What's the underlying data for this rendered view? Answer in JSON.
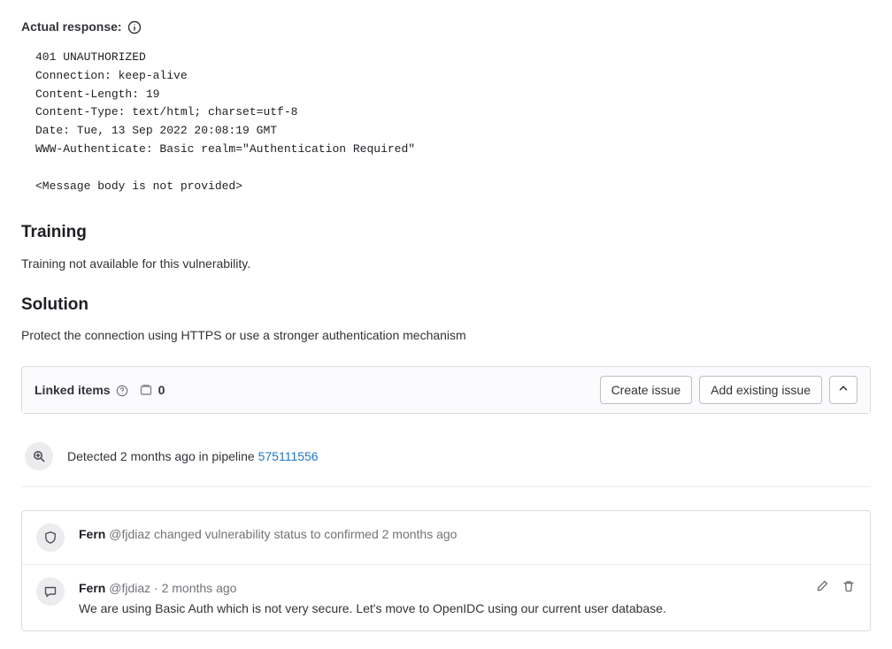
{
  "response": {
    "label": "Actual response:",
    "body": "401 UNAUTHORIZED\nConnection: keep-alive\nContent-Length: 19\nContent-Type: text/html; charset=utf-8\nDate: Tue, 13 Sep 2022 20:08:19 GMT\nWWW-Authenticate: Basic realm=\"Authentication Required\"\n\n<Message body is not provided>"
  },
  "training": {
    "heading": "Training",
    "text": "Training not available for this vulnerability."
  },
  "solution": {
    "heading": "Solution",
    "text": "Protect the connection using HTTPS or use a stronger authentication mechanism"
  },
  "linked": {
    "title": "Linked items",
    "count": "0",
    "create_issue": "Create issue",
    "add_existing": "Add existing issue"
  },
  "detection": {
    "text_prefix": "Detected 2 months ago in pipeline ",
    "pipeline_id": "575111556"
  },
  "events": {
    "status": {
      "author": "Fern",
      "handle": "@fjdiaz",
      "text": " changed vulnerability status to confirmed 2 months ago"
    },
    "comment": {
      "author": "Fern",
      "handle": "@fjdiaz",
      "sep": " · ",
      "time": "2 months ago",
      "body": "We are using Basic Auth which is not very secure. Let's move to OpenIDC using our current user database."
    }
  }
}
